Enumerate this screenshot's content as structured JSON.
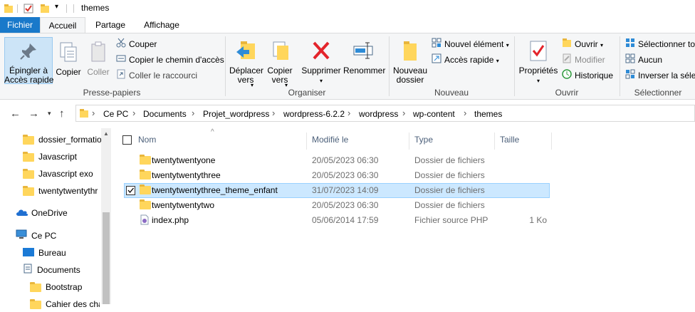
{
  "window": {
    "title": "themes"
  },
  "tabs": [
    {
      "label": "Fichier"
    },
    {
      "label": "Accueil"
    },
    {
      "label": "Partage"
    },
    {
      "label": "Affichage"
    }
  ],
  "ribbon": {
    "presse_papiers": {
      "pin": "Épingler à\nAccès rapide",
      "copier": "Copier",
      "coller": "Coller",
      "couper": "Couper",
      "copier_chemin": "Copier le chemin d'accès",
      "coller_raccourci": "Coller le raccourci",
      "label": "Presse-papiers"
    },
    "organiser": {
      "deplacer": "Déplacer\nvers",
      "copier_vers": "Copier\nvers",
      "supprimer": "Supprimer",
      "renommer": "Renommer",
      "label": "Organiser"
    },
    "nouveau": {
      "nouveau_dossier": "Nouveau\ndossier",
      "nouvel_element": "Nouvel élément",
      "acces_rapide": "Accès rapide",
      "label": "Nouveau"
    },
    "ouvrir": {
      "proprietes": "Propriétés",
      "ouvrir": "Ouvrir",
      "modifier": "Modifier",
      "historique": "Historique",
      "label": "Ouvrir"
    },
    "selectionner": {
      "tout": "Sélectionner tout",
      "aucun": "Aucun",
      "inverser": "Inverser la sélection",
      "label": "Sélectionner"
    }
  },
  "breadcrumb": [
    "Ce PC",
    "Documents",
    "Projet_wordpress",
    "wordpress-6.2.2",
    "wordpress",
    "wp-content",
    "themes"
  ],
  "sidebar": {
    "items": [
      {
        "label": "dossier_formatio",
        "kind": "folder"
      },
      {
        "label": "Javascript",
        "kind": "folder"
      },
      {
        "label": "Javascript exo",
        "kind": "folder"
      },
      {
        "label": "twentytwentythr",
        "kind": "folder"
      },
      {
        "label": "OneDrive",
        "kind": "onedrive"
      },
      {
        "label": "Ce PC",
        "kind": "pc"
      },
      {
        "label": "Bureau",
        "kind": "desktop"
      },
      {
        "label": "Documents",
        "kind": "documents"
      },
      {
        "label": "Bootstrap",
        "kind": "folder"
      },
      {
        "label": "Cahier des cha",
        "kind": "folder"
      }
    ]
  },
  "columns": {
    "name": "Nom",
    "modified": "Modifié le",
    "type": "Type",
    "size": "Taille"
  },
  "files": [
    {
      "name": "twentytwentyone",
      "modified": "20/05/2023 06:30",
      "type": "Dossier de fichiers",
      "size": "",
      "kind": "folder",
      "selected": false
    },
    {
      "name": "twentytwentythree",
      "modified": "20/05/2023 06:30",
      "type": "Dossier de fichiers",
      "size": "",
      "kind": "folder",
      "selected": false
    },
    {
      "name": "twentytwentythree_theme_enfant",
      "modified": "31/07/2023 14:09",
      "type": "Dossier de fichiers",
      "size": "",
      "kind": "folder",
      "selected": true
    },
    {
      "name": "twentytwentytwo",
      "modified": "20/05/2023 06:30",
      "type": "Dossier de fichiers",
      "size": "",
      "kind": "folder",
      "selected": false
    },
    {
      "name": "index.php",
      "modified": "05/06/2014 17:59",
      "type": "Fichier source PHP",
      "size": "1 Ko",
      "kind": "php",
      "selected": false
    }
  ],
  "colors": {
    "accent": "#1979ca",
    "selection": "#cce8ff",
    "folder": "#ffd65c"
  }
}
